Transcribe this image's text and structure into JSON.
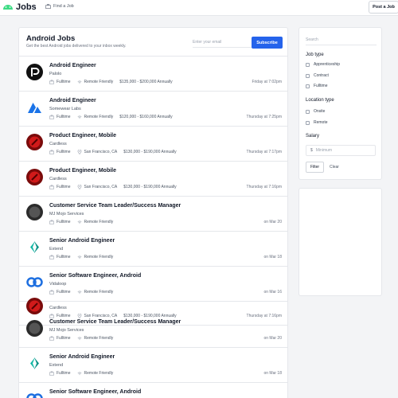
{
  "header": {
    "brand": "Jobs",
    "nav_find": "Find a Job",
    "post_button": "Post a Job",
    "logo_color": "#3ddc84"
  },
  "main": {
    "title": "Android Jobs",
    "subtitle": "Get the best Android jobs delivered to your inbox weekly.",
    "email_placeholder": "Enter your email",
    "subscribe_label": "Subscribe",
    "accent": "#2563eb"
  },
  "jobs": [
    {
      "title": "Android Engineer",
      "company": "Palolo",
      "type": "Fulltime",
      "location": "Remote Friendly",
      "salary": "$135,000 - $200,000 Annually",
      "time": "Friday at 7:02pm",
      "logo": "palolo-logo"
    },
    {
      "title": "Android Engineer",
      "company": "Somewear Labs",
      "type": "Fulltime",
      "location": "Remote Friendly",
      "salary": "$120,000 - $160,000 Annually",
      "time": "Thursday at 7:25pm",
      "logo": "somewear-logo"
    },
    {
      "title": "Product Engineer, Mobile",
      "company": "Cardless",
      "type": "Fulltime",
      "location": "San Francisco, CA",
      "salary": "$130,000 - $190,000 Annually",
      "time": "Thursday at 7:17pm",
      "logo": "cardless-logo"
    },
    {
      "title": "Product Engineer, Mobile",
      "company": "Cardless",
      "type": "Fulltime",
      "location": "San Francisco, CA",
      "salary": "$130,000 - $190,000 Annually",
      "time": "Thursday at 7:16pm",
      "logo": "cardless-logo"
    },
    {
      "title": "Customer Service Team Leader/Success Manager",
      "company": "MJ Mojo Services",
      "type": "Fulltime",
      "location": "Remote Friendly",
      "salary": "",
      "time": "on Mar 20",
      "logo": "mjmojo-logo"
    },
    {
      "title": "Senior Android Engineer",
      "company": "Extend",
      "type": "Fulltime",
      "location": "Remote Friendly",
      "salary": "",
      "time": "on Mar 18",
      "logo": "extend-logo"
    },
    {
      "title": "Senior Software Engineer, Android",
      "company": "Vidaloop",
      "type": "Fulltime",
      "location": "Remote Friendly",
      "salary": "",
      "time": "on Mar 16",
      "logo": "vidaloop-logo"
    },
    {
      "title": "",
      "company": "Cardless",
      "type": "Fulltime",
      "location": "San Francisco, CA",
      "salary": "$130,000 - $190,000 Annually",
      "time": "Thursday at 7:16pm",
      "logo": "cardless-logo"
    },
    {
      "title": "Customer Service Team Leader/Success Manager",
      "company": "MJ Mojo Services",
      "type": "Fulltime",
      "location": "Remote Friendly",
      "salary": "",
      "time": "on Mar 20",
      "logo": "mjmojo-logo"
    },
    {
      "title": "Senior Android Engineer",
      "company": "Extend",
      "type": "Fulltime",
      "location": "Remote Friendly",
      "salary": "",
      "time": "on Mar 18",
      "logo": "extend-logo"
    },
    {
      "title": "Senior Software Engineer, Android",
      "company": "",
      "type": "",
      "location": "",
      "salary": "",
      "time": "",
      "logo": "vidaloop-logo"
    }
  ],
  "sidebar": {
    "search_placeholder": "Search",
    "job_type_label": "Job type",
    "job_types": [
      "Apprenticeship",
      "Contract",
      "Fulltime"
    ],
    "location_label": "Location type",
    "location_types": [
      "Onsite",
      "Remote"
    ],
    "salary_label": "Salary",
    "salary_currency": "$",
    "salary_placeholder": "Minimum",
    "filter_label": "Filter",
    "clear_label": "Clear"
  }
}
